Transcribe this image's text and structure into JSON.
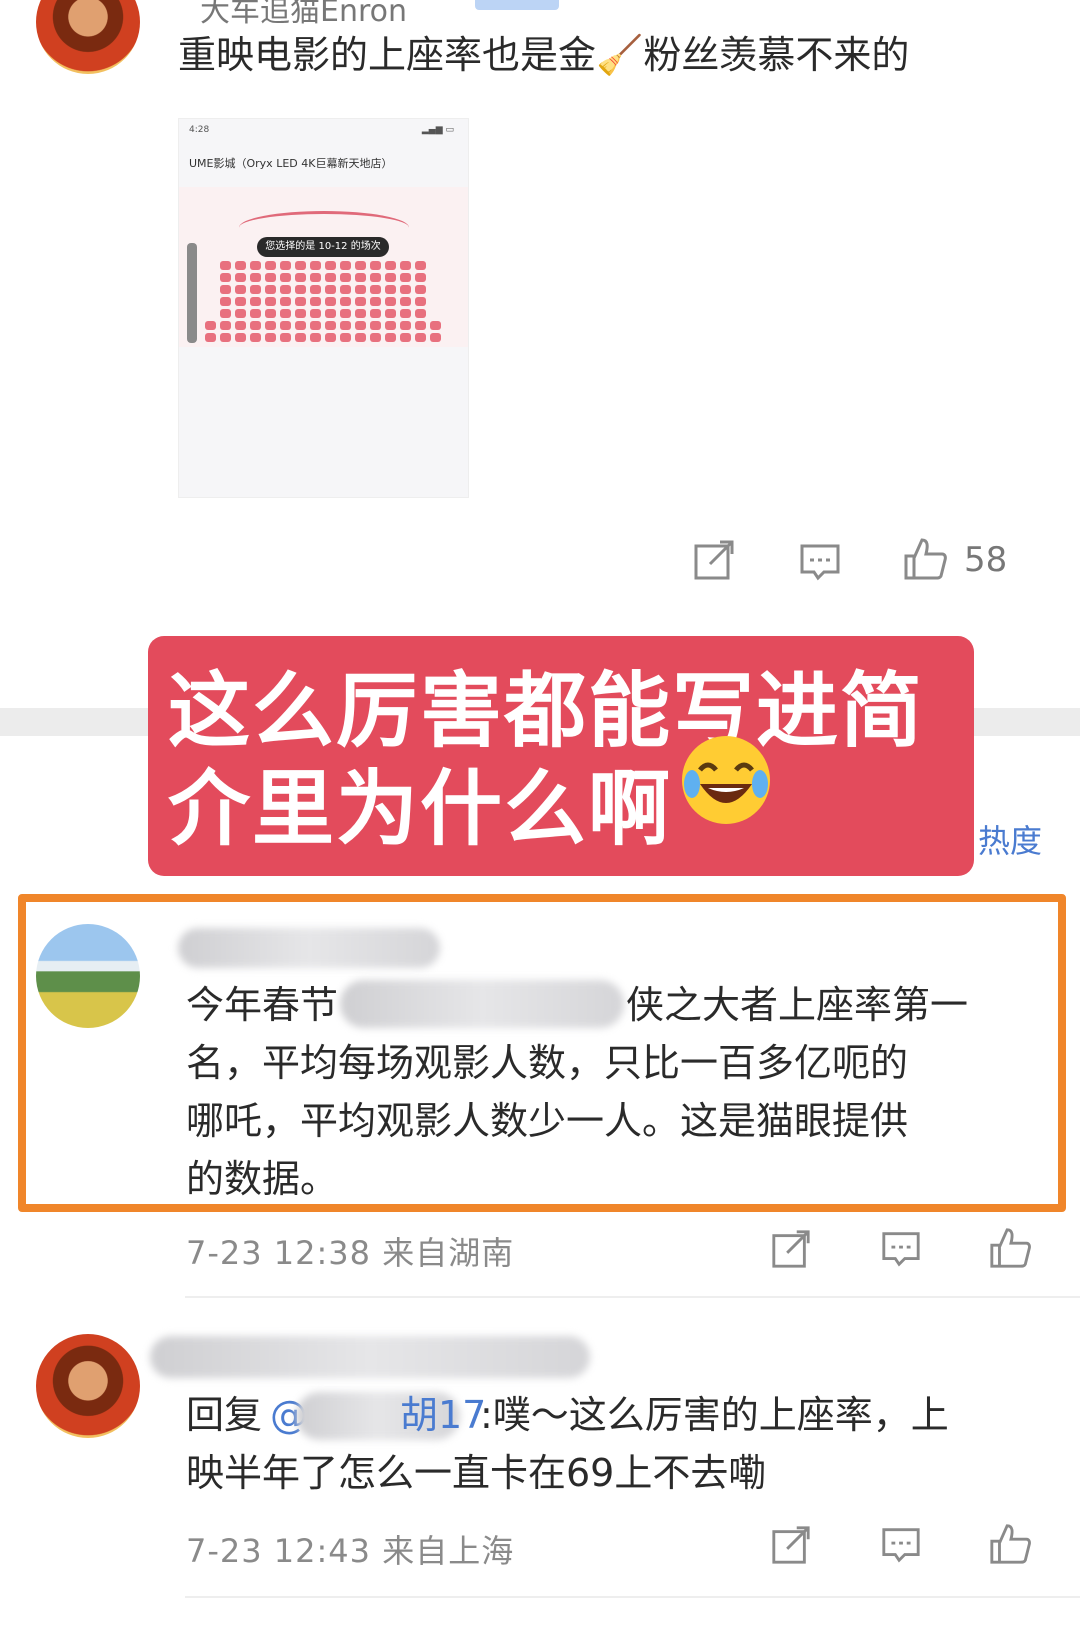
{
  "top_comment": {
    "username": "大车追猫Enron",
    "text": "重映电影的上座率也是金🧹粉丝羡慕不来的",
    "like_count": "58",
    "screenshot": {
      "time": "4:28",
      "cinema": "UME影城（Oryx LED 4K巨幕新天地店）",
      "pill_text": "您选择的是 10-12 的场次"
    }
  },
  "caption": {
    "line1": "这么厉害都能写进简",
    "line2": "介里为什么啊"
  },
  "sort_label": "热度",
  "comment_1": {
    "text_line1": "今年春节",
    "text_line1b": "侠之大者上座率第一",
    "text_line2": "名，平均每场观影人数，只比一百多亿呃的",
    "text_line3": "哪吒，平均观影人数少一人。这是猫眼提供",
    "text_line4": "的数据。",
    "meta": "7-23 12:38 来自湖南"
  },
  "comment_2": {
    "reply_prefix": "回复",
    "mention": "@",
    "mention_suffix": "胡17",
    "text": ":噗～这么厉害的上座率，上",
    "text_line2": "映半年了怎么一直卡在69上不去嘞",
    "meta": "7-23 12:43 来自上海"
  },
  "colors": {
    "caption_bg": "#e34b5c",
    "highlight_border": "#f0862a",
    "link_blue": "#4a7bd0"
  }
}
